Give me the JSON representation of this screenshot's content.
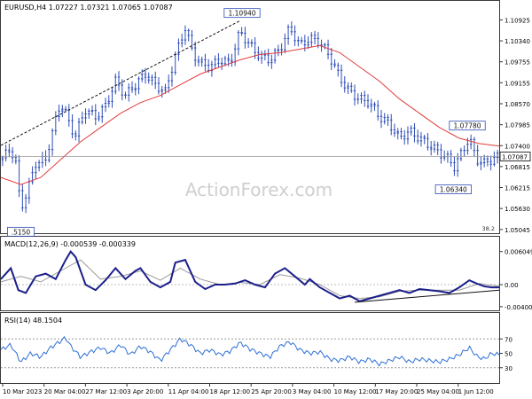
{
  "chart_data": [
    {
      "type": "candlestick",
      "title": "EURUSD,H4  1.07227 1.07321 1.07065 1.07087",
      "watermark": "ActionForex.com",
      "y_ticks": [
        "1.10925",
        "1.10340",
        "1.09755",
        "1.09155",
        "1.08570",
        "1.07985",
        "1.07400",
        "1.06815",
        "1.06215",
        "1.05630",
        "1.05045"
      ],
      "ylim": [
        1.0496,
        1.1118
      ],
      "current_price": "1.07087",
      "current_price_value": 1.07087,
      "annotations": [
        {
          "text": "1.10940",
          "value": 1.1094,
          "anchor": "peak",
          "at": 0.484
        },
        {
          "text": "1.07780",
          "value": 1.0778,
          "anchor": "recent-high",
          "at": 0.936
        },
        {
          "text": "1.06340",
          "value": 1.0634,
          "anchor": "recent-low",
          "at": 0.908
        },
        {
          "text": ".5150",
          "value": 1.0515,
          "anchor": "early-low",
          "at": 0.04
        }
      ],
      "corner_label": "38.2",
      "close_path": [
        [
          0.0,
          1.07
        ],
        [
          0.02,
          1.073
        ],
        [
          0.03,
          1.069
        ],
        [
          0.04,
          1.056
        ],
        [
          0.055,
          1.062
        ],
        [
          0.07,
          1.069
        ],
        [
          0.09,
          1.07
        ],
        [
          0.1,
          1.076
        ],
        [
          0.12,
          1.086
        ],
        [
          0.13,
          1.083
        ],
        [
          0.14,
          1.079
        ],
        [
          0.15,
          1.077
        ],
        [
          0.17,
          1.084
        ],
        [
          0.19,
          1.082
        ],
        [
          0.21,
          1.085
        ],
        [
          0.23,
          1.092
        ],
        [
          0.25,
          1.088
        ],
        [
          0.27,
          1.091
        ],
        [
          0.29,
          1.094
        ],
        [
          0.31,
          1.091
        ],
        [
          0.33,
          1.089
        ],
        [
          0.35,
          1.099
        ],
        [
          0.37,
          1.107
        ],
        [
          0.385,
          1.1
        ],
        [
          0.4,
          1.097
        ],
        [
          0.42,
          1.096
        ],
        [
          0.44,
          1.098
        ],
        [
          0.46,
          1.097
        ],
        [
          0.48,
          1.106
        ],
        [
          0.5,
          1.102
        ],
        [
          0.52,
          1.099
        ],
        [
          0.54,
          1.098
        ],
        [
          0.56,
          1.101
        ],
        [
          0.58,
          1.107
        ],
        [
          0.6,
          1.102
        ],
        [
          0.62,
          1.104
        ],
        [
          0.64,
          1.103
        ],
        [
          0.66,
          1.099
        ],
        [
          0.68,
          1.093
        ],
        [
          0.7,
          1.089
        ],
        [
          0.72,
          1.087
        ],
        [
          0.74,
          1.086
        ],
        [
          0.76,
          1.082
        ],
        [
          0.78,
          1.08
        ],
        [
          0.8,
          1.076
        ],
        [
          0.82,
          1.078
        ],
        [
          0.84,
          1.076
        ],
        [
          0.86,
          1.074
        ],
        [
          0.88,
          1.072
        ],
        [
          0.9,
          1.07
        ],
        [
          0.91,
          1.068
        ],
        [
          0.925,
          1.072
        ],
        [
          0.94,
          1.076
        ],
        [
          0.955,
          1.07
        ],
        [
          0.97,
          1.069
        ],
        [
          0.985,
          1.07
        ],
        [
          1.0,
          1.0709
        ]
      ],
      "ma_path": [
        [
          0.0,
          1.065
        ],
        [
          0.04,
          1.063
        ],
        [
          0.08,
          1.065
        ],
        [
          0.12,
          1.07
        ],
        [
          0.16,
          1.075
        ],
        [
          0.2,
          1.079
        ],
        [
          0.24,
          1.083
        ],
        [
          0.28,
          1.086
        ],
        [
          0.32,
          1.088
        ],
        [
          0.36,
          1.091
        ],
        [
          0.4,
          1.094
        ],
        [
          0.44,
          1.096
        ],
        [
          0.48,
          1.098
        ],
        [
          0.52,
          1.0995
        ],
        [
          0.56,
          1.1
        ],
        [
          0.6,
          1.101
        ],
        [
          0.64,
          1.102
        ],
        [
          0.68,
          1.1
        ],
        [
          0.72,
          1.096
        ],
        [
          0.76,
          1.092
        ],
        [
          0.8,
          1.087
        ],
        [
          0.84,
          1.083
        ],
        [
          0.88,
          1.079
        ],
        [
          0.92,
          1.076
        ],
        [
          0.96,
          1.0745
        ],
        [
          1.0,
          1.0738
        ]
      ],
      "trendline_path": [
        [
          0.0,
          1.074
        ],
        [
          0.48,
          1.109
        ]
      ],
      "colors": {
        "price": "#2e4db8",
        "ma": "#e23b3b",
        "trendline": "#111111"
      }
    },
    {
      "type": "line",
      "title": "MACD(12,26,9) -0.000539 -0.000339",
      "y_ticks": [
        "0.006049",
        "0.00",
        "-0.004005"
      ],
      "ylim": [
        -0.0045,
        0.0066
      ],
      "zero_label": "0.00",
      "macd_path": [
        [
          0.0,
          0.001
        ],
        [
          0.02,
          0.003
        ],
        [
          0.035,
          -0.001
        ],
        [
          0.05,
          -0.0015
        ],
        [
          0.07,
          0.0015
        ],
        [
          0.09,
          0.002
        ],
        [
          0.11,
          0.001
        ],
        [
          0.13,
          0.0045
        ],
        [
          0.14,
          0.006
        ],
        [
          0.15,
          0.005
        ],
        [
          0.17,
          0.0
        ],
        [
          0.19,
          -0.001
        ],
        [
          0.21,
          0.0008
        ],
        [
          0.23,
          0.003
        ],
        [
          0.25,
          0.001
        ],
        [
          0.27,
          0.0025
        ],
        [
          0.28,
          0.003
        ],
        [
          0.3,
          0.0005
        ],
        [
          0.32,
          -0.0005
        ],
        [
          0.34,
          0.0005
        ],
        [
          0.35,
          0.004
        ],
        [
          0.37,
          0.0045
        ],
        [
          0.39,
          0.0005
        ],
        [
          0.41,
          -0.0008
        ],
        [
          0.43,
          0.0
        ],
        [
          0.45,
          0.0
        ],
        [
          0.47,
          0.0002
        ],
        [
          0.49,
          0.0008
        ],
        [
          0.51,
          0.0
        ],
        [
          0.53,
          -0.0005
        ],
        [
          0.55,
          0.002
        ],
        [
          0.57,
          0.003
        ],
        [
          0.59,
          0.0015
        ],
        [
          0.61,
          0.0
        ],
        [
          0.62,
          0.001
        ],
        [
          0.64,
          -0.0005
        ],
        [
          0.66,
          -0.0015
        ],
        [
          0.68,
          -0.0025
        ],
        [
          0.7,
          -0.002
        ],
        [
          0.72,
          -0.003
        ],
        [
          0.74,
          -0.0025
        ],
        [
          0.76,
          -0.002
        ],
        [
          0.78,
          -0.0015
        ],
        [
          0.8,
          -0.001
        ],
        [
          0.82,
          -0.0015
        ],
        [
          0.84,
          -0.0008
        ],
        [
          0.86,
          -0.001
        ],
        [
          0.88,
          -0.0012
        ],
        [
          0.9,
          -0.0015
        ],
        [
          0.92,
          -0.0005
        ],
        [
          0.94,
          0.0008
        ],
        [
          0.955,
          0.0002
        ],
        [
          0.97,
          -0.0003
        ],
        [
          0.985,
          -0.0005
        ],
        [
          1.0,
          -0.0005
        ]
      ],
      "signal_path": [
        [
          0.0,
          0.0005
        ],
        [
          0.04,
          0.0015
        ],
        [
          0.08,
          0.0005
        ],
        [
          0.12,
          0.0025
        ],
        [
          0.16,
          0.0045
        ],
        [
          0.2,
          0.001
        ],
        [
          0.24,
          0.0015
        ],
        [
          0.28,
          0.0025
        ],
        [
          0.32,
          0.0008
        ],
        [
          0.36,
          0.003
        ],
        [
          0.4,
          0.001
        ],
        [
          0.44,
          0.0
        ],
        [
          0.48,
          0.0004
        ],
        [
          0.52,
          0.0
        ],
        [
          0.56,
          0.0018
        ],
        [
          0.6,
          0.0012
        ],
        [
          0.64,
          0.0
        ],
        [
          0.68,
          -0.002
        ],
        [
          0.72,
          -0.0025
        ],
        [
          0.76,
          -0.0022
        ],
        [
          0.8,
          -0.0012
        ],
        [
          0.84,
          -0.001
        ],
        [
          0.88,
          -0.001
        ],
        [
          0.92,
          -0.001
        ],
        [
          0.96,
          0.0002
        ],
        [
          1.0,
          -0.0003
        ]
      ],
      "trendline_path": [
        [
          0.71,
          -0.0032
        ],
        [
          1.0,
          -0.001
        ]
      ],
      "colors": {
        "macd": "#1b1f8a",
        "signal": "#9a9a9a",
        "trendline": "#111111"
      }
    },
    {
      "type": "line",
      "title": "RSI(14) 48.1504",
      "y_ticks": [
        "70",
        "50",
        "30"
      ],
      "ylim": [
        10,
        90
      ],
      "rsi_path": [
        [
          0.0,
          55
        ],
        [
          0.02,
          62
        ],
        [
          0.04,
          38
        ],
        [
          0.06,
          50
        ],
        [
          0.08,
          45
        ],
        [
          0.1,
          58
        ],
        [
          0.12,
          67
        ],
        [
          0.13,
          72
        ],
        [
          0.14,
          60
        ],
        [
          0.16,
          45
        ],
        [
          0.18,
          52
        ],
        [
          0.2,
          58
        ],
        [
          0.22,
          50
        ],
        [
          0.24,
          62
        ],
        [
          0.26,
          48
        ],
        [
          0.28,
          60
        ],
        [
          0.3,
          52
        ],
        [
          0.32,
          40
        ],
        [
          0.34,
          55
        ],
        [
          0.36,
          70
        ],
        [
          0.38,
          62
        ],
        [
          0.4,
          50
        ],
        [
          0.42,
          55
        ],
        [
          0.44,
          48
        ],
        [
          0.46,
          53
        ],
        [
          0.48,
          65
        ],
        [
          0.5,
          56
        ],
        [
          0.52,
          50
        ],
        [
          0.54,
          45
        ],
        [
          0.56,
          60
        ],
        [
          0.58,
          66
        ],
        [
          0.6,
          55
        ],
        [
          0.62,
          50
        ],
        [
          0.64,
          52
        ],
        [
          0.66,
          42
        ],
        [
          0.68,
          40
        ],
        [
          0.7,
          45
        ],
        [
          0.72,
          38
        ],
        [
          0.74,
          42
        ],
        [
          0.76,
          35
        ],
        [
          0.78,
          40
        ],
        [
          0.8,
          45
        ],
        [
          0.82,
          38
        ],
        [
          0.84,
          42
        ],
        [
          0.86,
          40
        ],
        [
          0.88,
          38
        ],
        [
          0.9,
          42
        ],
        [
          0.92,
          48
        ],
        [
          0.94,
          58
        ],
        [
          0.955,
          46
        ],
        [
          0.97,
          42
        ],
        [
          0.985,
          50
        ],
        [
          1.0,
          48
        ]
      ],
      "colors": {
        "rsi": "#2e6fd6",
        "level": "#9a9a9a"
      }
    }
  ],
  "x_axis": {
    "ticks": [
      "10 Mar 2023",
      "20 Mar 04:00",
      "27 Mar 12:00",
      "3 Apr 20:00",
      "11 Apr 04:00",
      "18 Apr 12:00",
      "25 Apr 20:00",
      "3 May 04:00",
      "10 May 12:00",
      "17 May 20:00",
      "25 May 04:00",
      "1 Jun 12:00"
    ]
  }
}
